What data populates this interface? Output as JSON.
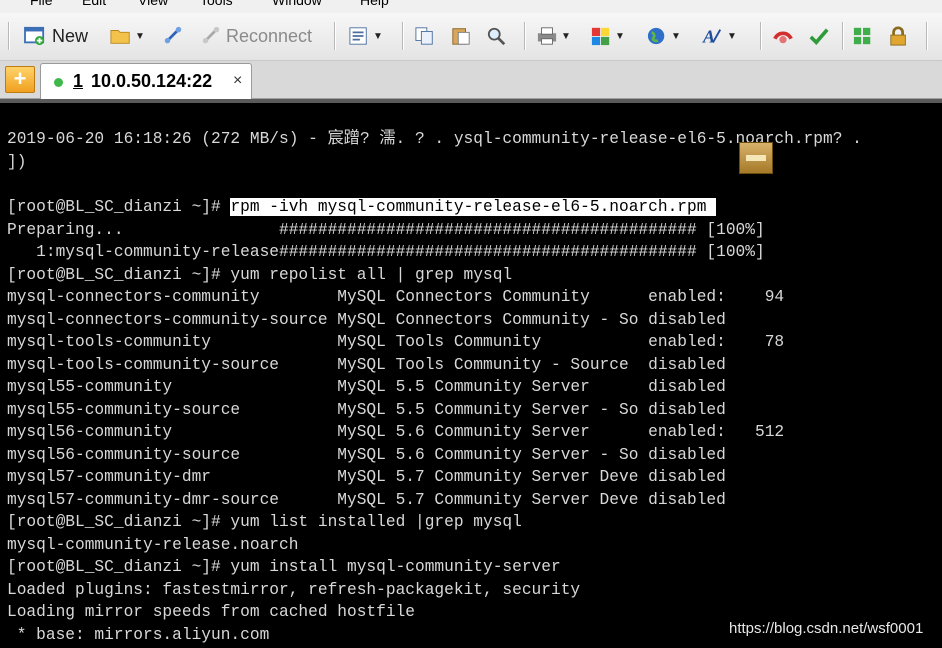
{
  "menubar": {
    "items": [
      "File",
      "Edit",
      "View",
      "Tools",
      "Window",
      "Help"
    ]
  },
  "toolbar": {
    "new_label": "New",
    "reconnect_label": "Reconnect"
  },
  "tabs": [
    {
      "index": "1",
      "title": " 10.0.50.124:22",
      "close": "×"
    }
  ],
  "terminal": {
    "lines": [
      "2019-06-20 16:18:26 (272 MB/s) - 宸蹭? 濡. ? . ysql-community-release-el6-5.noarch.rpm? .",
      "])",
      "",
      "[root@BL_SC_dianzi ~]# ",
      "Preparing...                ########################################### [100%]",
      "   1:mysql-community-release########################################### [100%]",
      "[root@BL_SC_dianzi ~]# yum repolist all | grep mysql",
      "mysql-connectors-community        MySQL Connectors Community      enabled:    94",
      "mysql-connectors-community-source MySQL Connectors Community - So disabled",
      "mysql-tools-community             MySQL Tools Community           enabled:    78",
      "mysql-tools-community-source      MySQL Tools Community - Source  disabled",
      "mysql55-community                 MySQL 5.5 Community Server      disabled",
      "mysql55-community-source          MySQL 5.5 Community Server - So disabled",
      "mysql56-community                 MySQL 5.6 Community Server      enabled:   512",
      "mysql56-community-source          MySQL 5.6 Community Server - So disabled",
      "mysql57-community-dmr             MySQL 5.7 Community Server Deve disabled",
      "mysql57-community-dmr-source      MySQL 5.7 Community Server Deve disabled",
      "[root@BL_SC_dianzi ~]# yum list installed |grep mysql",
      "mysql-community-release.noarch",
      "[root@BL_SC_dianzi ~]# yum install mysql-community-server",
      "Loaded plugins: fastestmirror, refresh-packagekit, security",
      "Loading mirror speeds from cached hostfile",
      " * base: mirrors.aliyun.com"
    ],
    "highlighted_command": "rpm -ivh mysql-community-release-el6-5.noarch.rpm "
  },
  "watermark": "https://blog.csdn.net/wsf0001",
  "colors": {
    "terminal_bg": "#000000",
    "terminal_fg": "#d8d8d8",
    "selection_bg": "#ffffff",
    "tab_status": "#3fb84b",
    "add_tab": "#f0a020"
  },
  "icons": [
    "new-session-icon",
    "open-folder-icon",
    "connect-icon",
    "reconnect-icon",
    "script-icon",
    "copy-icon",
    "paste-icon",
    "find-icon",
    "print-icon",
    "color-icon",
    "globe-icon",
    "font-icon",
    "red-icon",
    "green-icon",
    "layout-icon",
    "lock-icon"
  ]
}
